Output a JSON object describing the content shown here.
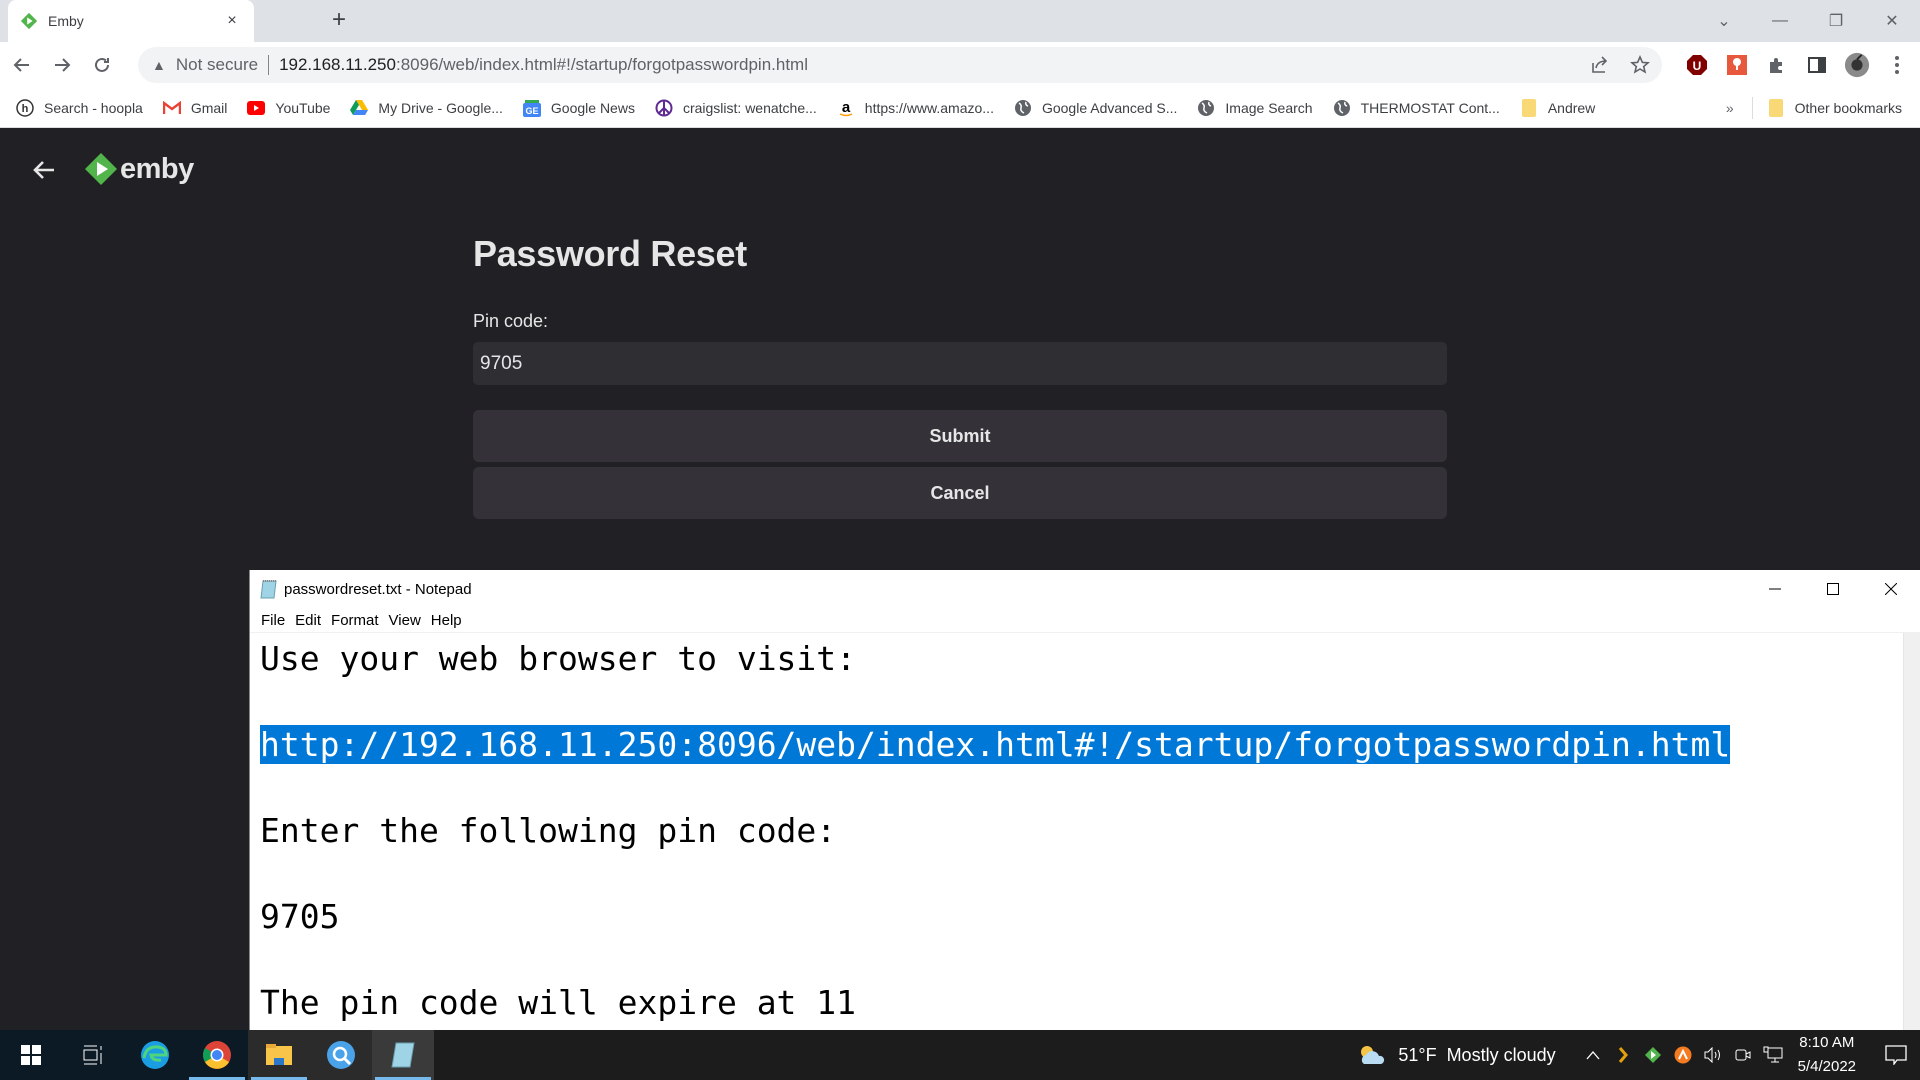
{
  "browser": {
    "tab": {
      "title": "Emby",
      "favicon": "emby-logo-icon",
      "close": "×"
    },
    "new_tab": "+",
    "window_controls": {
      "tab_search": "⌄",
      "minimize": "—",
      "restore": "❐",
      "close": "✕"
    },
    "nav": {
      "back": "←",
      "forward": "→",
      "reload": "⟳"
    },
    "address": {
      "security_label": "Not secure",
      "warning_icon": "▲",
      "url_host": "192.168.11.250",
      "url_rest": ":8096/web/index.html#!/startup/forgotpasswordpin.html"
    },
    "toolbar_icons": [
      "share-icon",
      "bookmark-star-icon",
      "ublock-extension-icon",
      "nuke-extension-icon",
      "extensions-puzzle-icon",
      "side-panel-icon",
      "profile-avatar",
      "menu-kebab-icon"
    ],
    "bookmarks": [
      {
        "label": "Search - hoopla",
        "icon": "hoopla-icon"
      },
      {
        "label": "Gmail",
        "icon": "gmail-icon"
      },
      {
        "label": "YouTube",
        "icon": "youtube-icon"
      },
      {
        "label": "My Drive - Google...",
        "icon": "google-drive-icon"
      },
      {
        "label": "Google News",
        "icon": "google-news-icon"
      },
      {
        "label": "craigslist: wenatche...",
        "icon": "peace-icon"
      },
      {
        "label": "https://www.amazo...",
        "icon": "amazon-icon"
      },
      {
        "label": "Google Advanced S...",
        "icon": "globe-icon"
      },
      {
        "label": "Image Search",
        "icon": "globe-icon"
      },
      {
        "label": "THERMOSTAT Cont...",
        "icon": "globe-icon"
      },
      {
        "label": "Andrew",
        "icon": "folder-icon"
      }
    ],
    "bookmarks_overflow": "»",
    "other_bookmarks": "Other bookmarks"
  },
  "emby": {
    "logo_text": "emby",
    "brand_color": "#52b54b",
    "title": "Password Reset",
    "pin_label": "Pin code:",
    "pin_value": "9705",
    "submit_label": "Submit",
    "cancel_label": "Cancel"
  },
  "notepad": {
    "title": "passwordreset.txt - Notepad",
    "menu": [
      "File",
      "Edit",
      "Format",
      "View",
      "Help"
    ],
    "lines": [
      "Use your web browser to visit:",
      "",
      "http://192.168.11.250:8096/web/index.html#!/startup/forgotpasswordpin.html",
      "",
      "Enter the following pin code:",
      "",
      "9705",
      "",
      "The pin code will expire at 11"
    ],
    "selected_line": "http://192.168.11.250:8096/web/index.html#!/startup/forgotpasswordpin.html",
    "selection_color": "#0078d7"
  },
  "taskbar": {
    "apps": [
      "start-icon",
      "task-view-icon",
      "edge-icon",
      "chrome-icon",
      "file-explorer-icon",
      "search-app-icon",
      "notepad-icon"
    ],
    "weather": {
      "temp": "51°F",
      "condition": "Mostly cloudy"
    },
    "tray_chevron": "^",
    "time": "8:10 AM",
    "date": "5/4/2022"
  }
}
